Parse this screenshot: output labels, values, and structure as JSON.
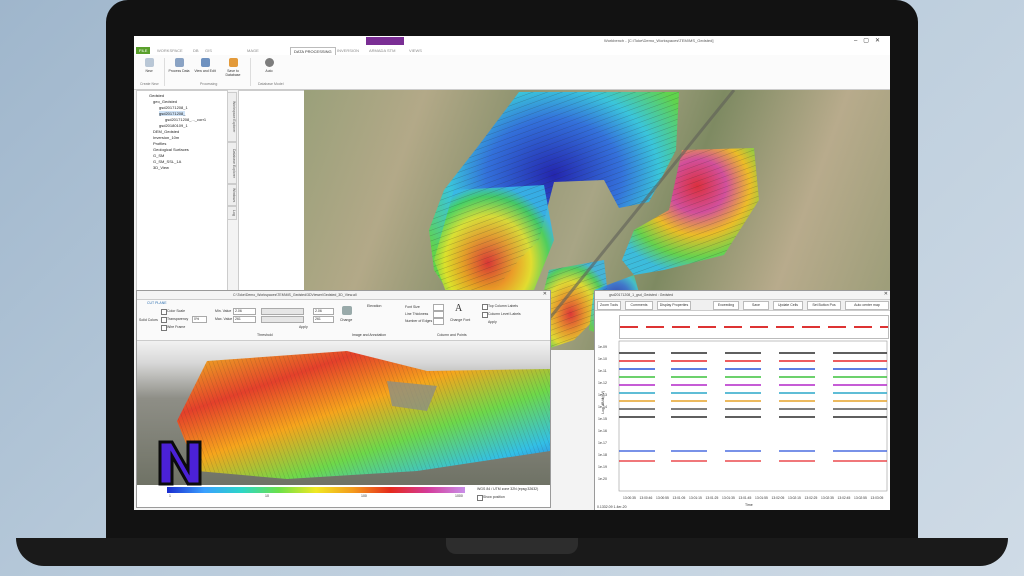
{
  "window": {
    "title": "Workbench - [C:\\Toke\\Demo_Workspaces\\TEM\\MS_Gedsted]"
  },
  "ribbon": {
    "tabs": [
      "FILE",
      "WORKSPACE",
      "DB",
      "GIS",
      "DATA PROCESSING",
      "INVERSION",
      "ARMADA STM",
      "MAGE",
      "VIEWS"
    ],
    "active_tab": "DATA PROCESSING",
    "buttons": [
      "New",
      "Process Data",
      "View and Edit",
      "Save to Database",
      "Auto"
    ],
    "groups": [
      "Create New",
      "Processing",
      "Database Model"
    ]
  },
  "tree": {
    "items": [
      "Gedsted",
      "geo_Gedsted",
      "gsd20171208_1",
      "gsd20171208_",
      "gsd20171208_..._corr1",
      "gsd20180109_1",
      "DEM_Gedsted",
      "Inversion_10m",
      "Profiles",
      "Geological Surfaces",
      "G_SM",
      "G_SM_SSL_1A",
      "3D_View"
    ]
  },
  "side_tabs": [
    "Workspace Explorer",
    "Database Explorer",
    "Windows",
    "Log"
  ],
  "view3d": {
    "path": "C:\\Toke\\Demo_Workspaces\\TEM\\MS_Gedsted\\3DViewer\\Gedsted_3D_View.all",
    "tab": "CUT PLANE",
    "labels": {
      "color_scale": "Color Scale",
      "transparency": "Transparency",
      "wire_frame": "Wire Frame",
      "min_value": "Min. Value",
      "max_value": "Max. Value",
      "threshold": "Threshold",
      "change": "Change",
      "elevation": "Elevation",
      "image_annotation": "Image and Annotation",
      "font_size": "Font Size",
      "line_thickness": "Line Thickness",
      "num_edges": "Number of Edges",
      "change_font": "Change Font",
      "top_labels": "Top Column Labels",
      "level_labels": "Column Level Labels",
      "apply": "Apply",
      "column_points": "Column and Points",
      "solid_colors": "Solid Colors",
      "apply_small": "Apply"
    },
    "values": {
      "transparency": "0%",
      "min_value": "2.06",
      "max_value": "261",
      "min_value2": "2.06",
      "max_value2": "261"
    },
    "colorbar_ticks": [
      "1",
      "10",
      "100",
      "1000"
    ],
    "projection": "WGS 84 / UTM zone 32N (epsg:32632)",
    "show_position": "Show position"
  },
  "plot": {
    "title": "gsd20171208_1_gsd_Gedsted : Gedsted",
    "buttons": [
      "Zoom Tools",
      "Comments",
      "Display Properties",
      "Exceeding",
      "Save",
      "Update Cells",
      "Set Button Pos",
      "Auto center map"
    ],
    "y_label": "Log. dB/dt(nV)",
    "y_ticks": [
      "1e-09",
      "1e-10",
      "1e-11",
      "1e-12",
      "1e-13",
      "1e-14",
      "1e-15",
      "1e-16",
      "1e-17",
      "1e-18",
      "1e-19",
      "1e-20"
    ],
    "x_label": "Time",
    "x_ticks": [
      "13:00:35",
      "13:00:46",
      "13:00:55",
      "13:01:05",
      "13:01:15",
      "13:01:25",
      "13:01:35",
      "13:01:45",
      "13:01:55",
      "13:02:05",
      "13:02:15",
      "13:02:25",
      "13:02:35",
      "13:02:45",
      "13:02:55",
      "13:03:05"
    ],
    "status": "0.1332.09    1.4er-20",
    "top_panel_label": "Comments"
  },
  "colors": {
    "accent": "#5aa02c",
    "ribbon_tab_purple": "#7a2e94",
    "laptop": "#121212"
  }
}
